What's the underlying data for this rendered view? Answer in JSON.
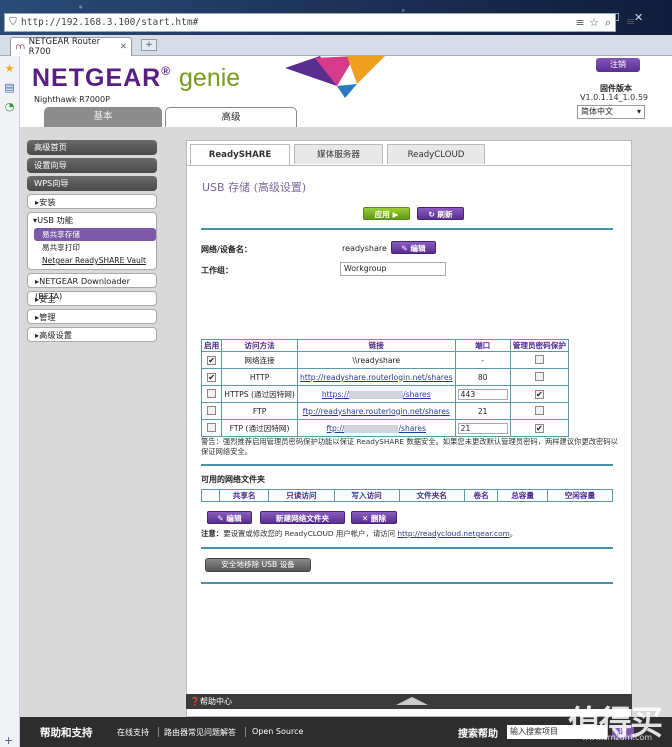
{
  "browser": {
    "url": "http://192.168.3.100/start.htm#",
    "tab_title": "NETGEAR Router R700"
  },
  "brand": {
    "logo_main": "NETGEAR",
    "logo_reg": "®",
    "logo_genie": "genie",
    "model": "Nighthawk R7000P",
    "logout": "注销",
    "fw_label": "固件版本",
    "fw_version": "V1.0.1.14_1.0.59",
    "language": "简体中文"
  },
  "main_tabs": {
    "basic": "基本",
    "advanced": "高级"
  },
  "menu": {
    "home": "高级首页",
    "setup_wizard": "设置向导",
    "wps_wizard": "WPS向导",
    "setup": "安装",
    "usb": "USB 功能",
    "usb_items": [
      "易共享存储",
      "易共享打印",
      "Netgear ReadySHARE Vault"
    ],
    "downloader": "NETGEAR Downloader (BETA)",
    "security": "安全",
    "admin": "管理",
    "advanced_setup": "高级设置"
  },
  "content_tabs": [
    "ReadySHARE",
    "媒体服务器",
    "ReadyCLOUD"
  ],
  "page_title": "USB 存储 (高级设置)",
  "buttons": {
    "apply": "应用",
    "refresh": "刷新",
    "edit": "编辑",
    "edit2": "编辑",
    "new_folder": "新建网络文件夹",
    "delete": "删除",
    "safe_remove": "安全地移除 USB 设备"
  },
  "network_device_label": "网络/设备名：",
  "network_device_value": "readyshare",
  "workgroup_label": "工作组：",
  "workgroup_value": "Workgroup",
  "share_table": {
    "headers": [
      "启用",
      "访问方法",
      "链接",
      "端口",
      "管理员密码保护"
    ],
    "rows": [
      {
        "method": "网络连接",
        "link": "\\\\readyshare",
        "port": "-"
      },
      {
        "method": "HTTP",
        "link": "http://readyshare.routerlogin.net/shares",
        "port": "80"
      },
      {
        "method": "HTTPS (通过因特网)",
        "link_pre": "https://",
        "link_post": "/shares",
        "port": "443"
      },
      {
        "method": "FTP",
        "link": "ftp://readyshare.routerlogin.net/shares",
        "port": "21"
      },
      {
        "method": "FTP (通过因特网)",
        "link_pre": "ftp://",
        "link_post": "/shares",
        "port": "21"
      }
    ]
  },
  "warning": "警告：强烈推荐启用管理员密码保护功能以保证 ReadySHARE 数据安全。如果您未更改默认管理员密码，两样建议你更改密码以保证网络安全。",
  "avail_title": "可用的网络文件夹",
  "avail_headers": [
    "共享名",
    "只读访问",
    "写入访问",
    "文件夹名",
    "卷名",
    "总容量",
    "空闲容量"
  ],
  "note_label": "注意：",
  "note_text": "要设置或修改您的 ReadyCLOUD 用户帐户，请访问",
  "note_link": "http://readycloud.netgear.com",
  "help_center": "帮助中心",
  "footer": {
    "title": "帮助和支持",
    "links": [
      "在线支持",
      "路由器常见问题解答",
      "Open Source"
    ],
    "search_label": "搜索帮助",
    "search_placeholder": "输入搜索项目",
    "search_go": "搜"
  },
  "watermark": {
    "main": "值得买",
    "sub": "www.smzdm.com"
  },
  "colors": {
    "accent": "#5a2e90",
    "apply": "#6ca820",
    "rule": "#4a8fa8"
  }
}
